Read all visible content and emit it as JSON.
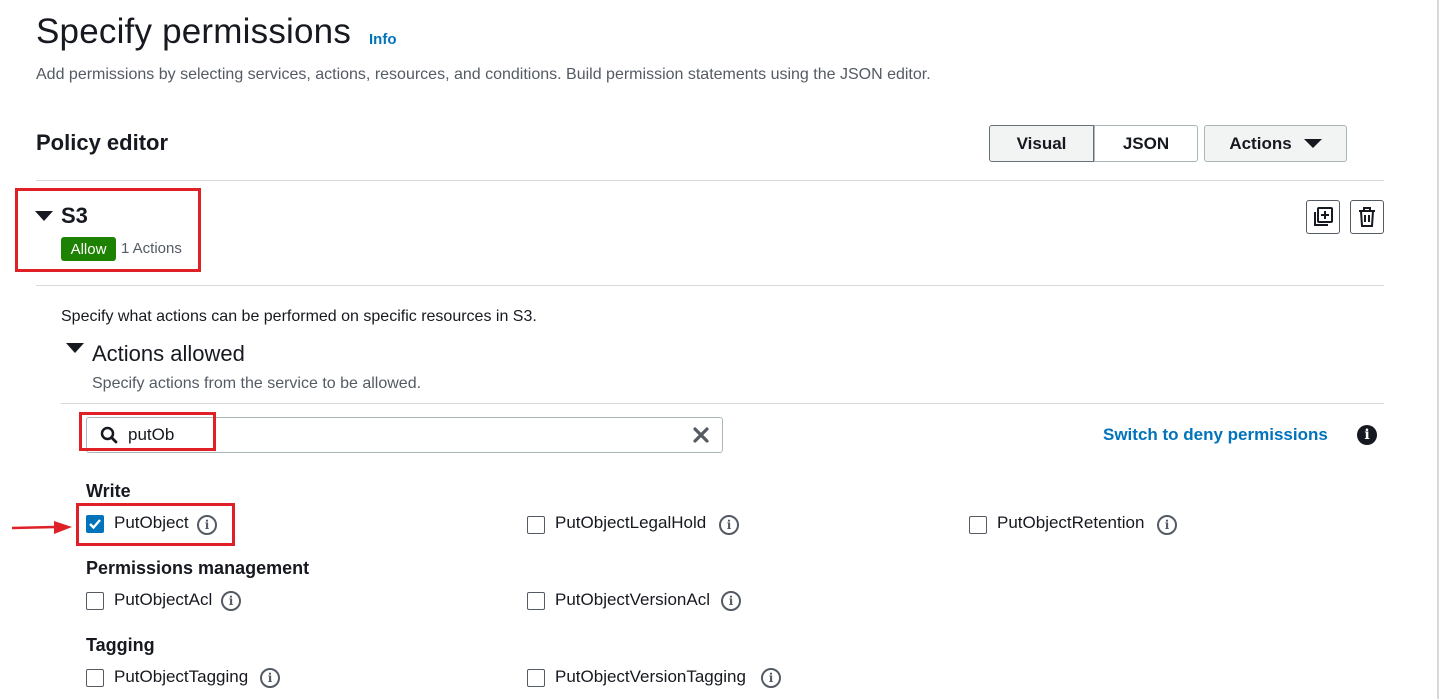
{
  "header": {
    "title": "Specify permissions",
    "info": "Info",
    "description": "Add permissions by selecting services, actions, resources, and conditions. Build permission statements using the JSON editor."
  },
  "policy_editor": {
    "title": "Policy editor",
    "modes": [
      "Visual",
      "JSON"
    ],
    "selected_mode": "Visual",
    "actions_menu": "Actions"
  },
  "statement": {
    "service": "S3",
    "effect": "Allow",
    "action_count": "1 Actions",
    "description": "Specify what actions can be performed on specific resources in S3."
  },
  "actions_allowed": {
    "title": "Actions allowed",
    "description": "Specify actions from the service to be allowed.",
    "search_value": "putOb",
    "deny_link": "Switch to deny permissions",
    "info_glyph": "i"
  },
  "groups": {
    "write": {
      "title": "Write",
      "items": [
        {
          "label": "PutObject",
          "checked": true
        },
        {
          "label": "PutObjectLegalHold",
          "checked": false
        },
        {
          "label": "PutObjectRetention",
          "checked": false
        }
      ]
    },
    "permissions": {
      "title": "Permissions management",
      "items": [
        {
          "label": "PutObjectAcl",
          "checked": false
        },
        {
          "label": "PutObjectVersionAcl",
          "checked": false
        }
      ]
    },
    "tagging": {
      "title": "Tagging",
      "items": [
        {
          "label": "PutObjectTagging",
          "checked": false
        },
        {
          "label": "PutObjectVersionTagging",
          "checked": false
        }
      ]
    }
  },
  "colors": {
    "link": "#0073bb",
    "allow": "#1d8102",
    "highlight": "#e02027",
    "checked": "#0073bb"
  },
  "icons": {
    "collapse": "caret-down-icon",
    "duplicate": "duplicate-icon",
    "delete": "trash-icon",
    "search": "search-icon",
    "clear": "close-icon",
    "info": "info-icon",
    "annotation": "red-arrow"
  }
}
